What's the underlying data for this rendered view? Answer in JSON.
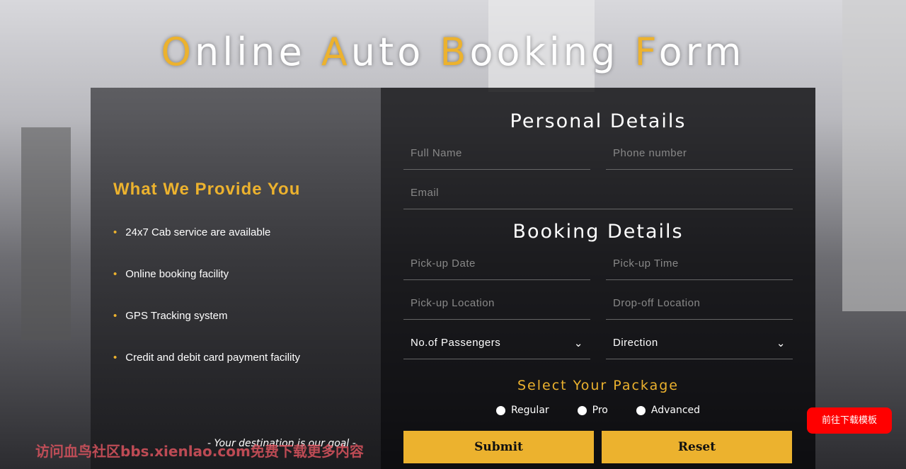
{
  "title": {
    "words": [
      {
        "cap": "O",
        "rest": "nline"
      },
      {
        "cap": "A",
        "rest": "uto"
      },
      {
        "cap": "B",
        "rest": "ooking"
      },
      {
        "cap": "F",
        "rest": "orm"
      }
    ]
  },
  "left": {
    "heading": "What We Provide You",
    "items": [
      "24x7 Cab service are available",
      "Online booking facility",
      "GPS Tracking system",
      "Credit and debit card payment facility"
    ],
    "tagline": "- Your destination is our goal -"
  },
  "personal": {
    "heading": "Personal Details",
    "full_name": "Full Name",
    "phone": "Phone number",
    "email": "Email"
  },
  "booking": {
    "heading": "Booking Details",
    "pickup_date": "Pick-up Date",
    "pickup_time": "Pick-up Time",
    "pickup_location": "Pick-up Location",
    "dropoff_location": "Drop-off Location",
    "passengers": "No.of Passengers",
    "direction": "Direction"
  },
  "package": {
    "heading": "Select Your Package",
    "options": [
      "Regular",
      "Pro",
      "Advanced"
    ]
  },
  "buttons": {
    "submit": "Submit",
    "reset": "Reset"
  },
  "download_button": "前往下载模板",
  "watermark": "访问血鸟社区bbs.xienlao.com免费下载更多内容",
  "colors": {
    "accent": "#ecb22e",
    "download": "#ff0000"
  }
}
